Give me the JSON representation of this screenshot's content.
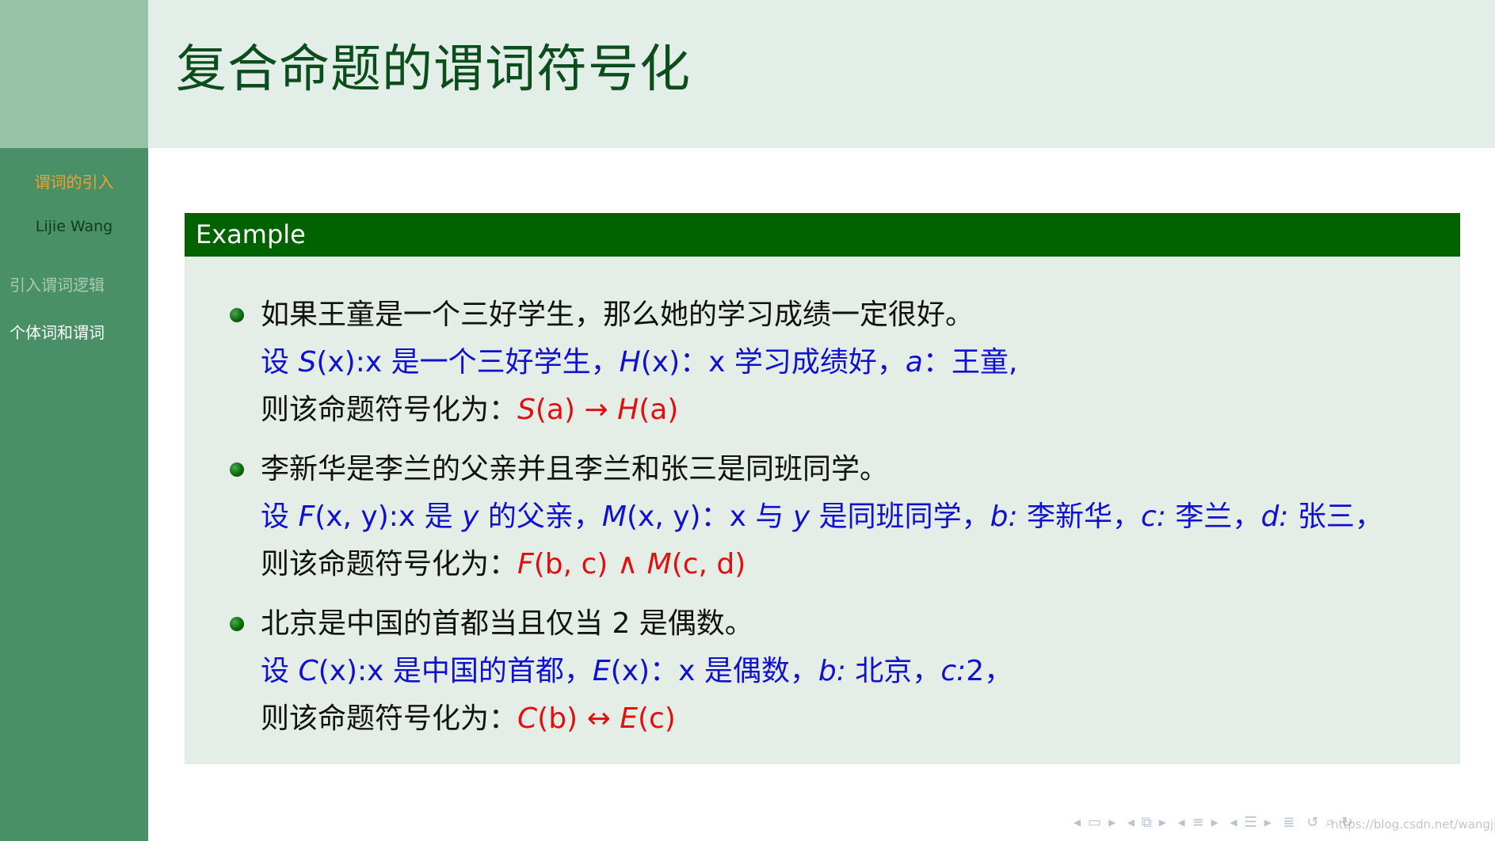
{
  "header": {
    "title": "复合命题的谓词符号化"
  },
  "sidebar": {
    "section": "谓词的引入",
    "author": "Lijie Wang",
    "items": [
      {
        "label": "引入谓词逻辑",
        "state": "muted"
      },
      {
        "label": "个体词和谓词",
        "state": "active"
      }
    ]
  },
  "block": {
    "title": "Example",
    "items": [
      {
        "statement": "如果王童是一个三好学生，那么她的学习成绩一定很好。",
        "def": {
          "lead": "设",
          "f1": "S",
          "a1": "(x)",
          "c1": ":x",
          "t1": "是一个三好学生，",
          "f2": "H",
          "a2": "(x)",
          "c2": "：x",
          "t2": "学习成绩好，",
          "v3": "a",
          "c3": "：",
          "t3": "王童,"
        },
        "result": {
          "lead": "则该命题符号化为：",
          "f1": "S",
          "a1": "(a)",
          "op": "→",
          "f2": "H",
          "a2": "(a)"
        }
      },
      {
        "statement": "李新华是李兰的父亲并且李兰和张三是同班同学。",
        "def": {
          "lead": "设",
          "f1": "F",
          "a1": "(x, y)",
          "c1": ":x",
          "t1": "是",
          "v1": "y",
          "t2": "的父亲，",
          "f2": "M",
          "a2": "(x, y)",
          "c2": "：x",
          "t3": "与",
          "v2": "y",
          "t4": "是同班同学，",
          "v3": "b:",
          "t5": "李新华，",
          "v4": "c:",
          "t6": "李兰，",
          "v5": "d:",
          "t7": "张三，"
        },
        "result": {
          "lead": "则该命题符号化为：",
          "f1": "F",
          "a1": "(b, c)",
          "op": "∧",
          "f2": "M",
          "a2": "(c, d)"
        }
      },
      {
        "statement": "北京是中国的首都当且仅当 2 是偶数。",
        "def": {
          "lead": "设",
          "f1": "C",
          "a1": "(x)",
          "c1": ":x",
          "t1": "是中国的首都，",
          "f2": "E",
          "a2": "(x)",
          "c2": "：x",
          "t2": "是偶数，",
          "v3": "b:",
          "t3": "北京，",
          "v4": "c:",
          "t4": "2，"
        },
        "result": {
          "lead": "则该命题符号化为：",
          "f1": "C",
          "a1": "(b)",
          "op": "↔",
          "f2": "E",
          "a2": "(c)"
        }
      }
    ]
  },
  "nav": {
    "icons": [
      "nav-left-arrow",
      "frame-icon",
      "nav-right-arrow",
      "nav-left-arrow",
      "subsection-icon",
      "nav-right-arrow",
      "nav-left-arrow",
      "section-icon",
      "nav-right-arrow",
      "nav-left-arrow",
      "doc-icon",
      "nav-right-arrow",
      "outline-icon",
      "back-icon",
      "search-icon",
      "fullscreen-icon"
    ]
  },
  "watermark": "https://blog.csdn.net/wangjie"
}
